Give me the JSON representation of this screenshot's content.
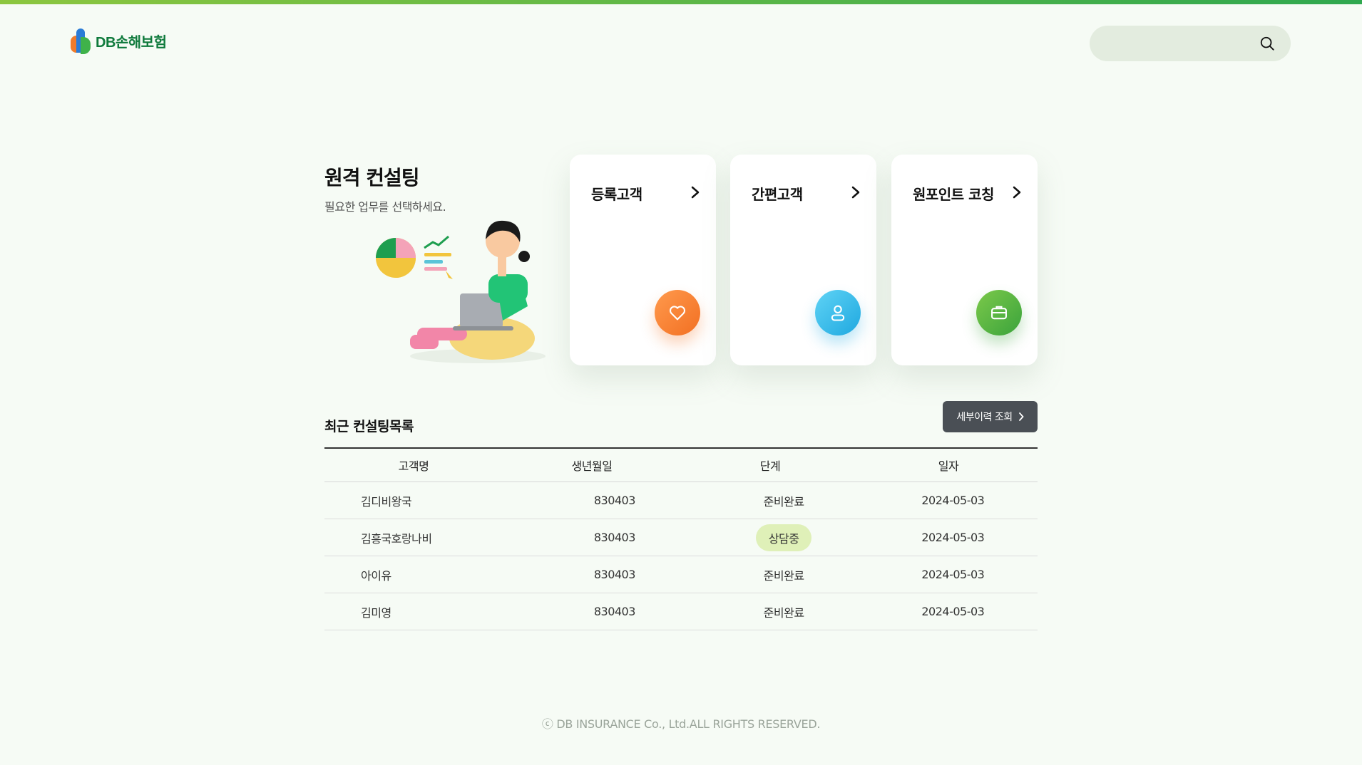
{
  "brand": {
    "logo_text": "DB손해보험"
  },
  "search": {
    "placeholder": ""
  },
  "hero": {
    "title": "원격 컨설팅",
    "subtitle": "필요한 업무를 선택하세요."
  },
  "cards": [
    {
      "title": "등록고객",
      "icon": "heart-icon",
      "color": "#f26f22"
    },
    {
      "title": "간편고객",
      "icon": "user-icon",
      "color": "#1fa8e0"
    },
    {
      "title": "원포인트 코칭",
      "icon": "briefcase-icon",
      "color": "#3aa33c"
    }
  ],
  "recent": {
    "title": "최근 컨설팅목록",
    "detail_button": "세부이력 조회",
    "columns": [
      "고객명",
      "생년월일",
      "단계",
      "일자"
    ],
    "rows": [
      {
        "name": "김디비왕국",
        "birth": "830403",
        "stage": "준비완료",
        "date": "2024-05-03",
        "highlight": false
      },
      {
        "name": "김흥국호랑나비",
        "birth": "830403",
        "stage": "상담중",
        "date": "2024-05-03",
        "highlight": true
      },
      {
        "name": "아이유",
        "birth": "830403",
        "stage": "준비완료",
        "date": "2024-05-03",
        "highlight": false
      },
      {
        "name": "김미영",
        "birth": "830403",
        "stage": "준비완료",
        "date": "2024-05-03",
        "highlight": false
      }
    ]
  },
  "footer": {
    "copyright": "ⓒ DB INSURANCE Co., Ltd.ALL RIGHTS RESERVED."
  },
  "colors": {
    "accent_green": "#2fa84f",
    "badge_bg": "#dff0b8"
  }
}
